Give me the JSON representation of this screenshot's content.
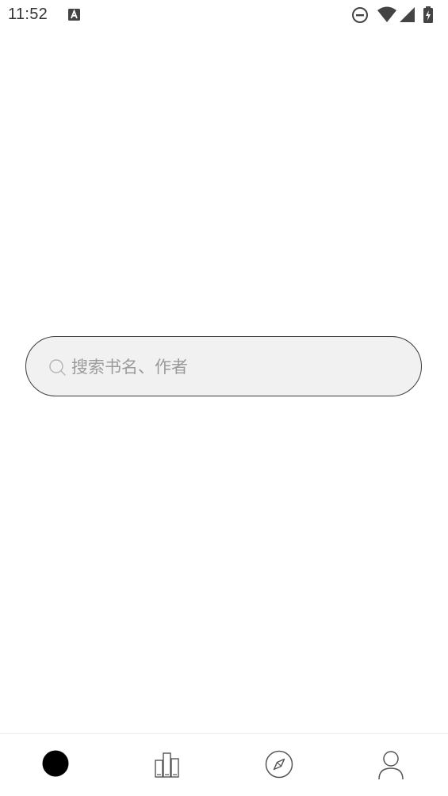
{
  "status_bar": {
    "time": "11:52",
    "notification_icon": "a-icon",
    "right_icons": [
      "do-not-disturb-icon",
      "wifi-icon",
      "cell-signal-icon",
      "battery-charging-icon"
    ]
  },
  "search": {
    "placeholder": "搜索书名、作者",
    "icon": "search-icon",
    "background_color": "#f1f1f1",
    "border_color": "#3a3a3a",
    "placeholder_color": "#9b9b9b"
  },
  "bottom_nav": {
    "items": [
      {
        "icon": "home-dot-icon",
        "active": true
      },
      {
        "icon": "bookshelf-icon",
        "active": false
      },
      {
        "icon": "compass-icon",
        "active": false
      },
      {
        "icon": "profile-icon",
        "active": false
      }
    ],
    "active_color": "#000000",
    "inactive_color": "#555555"
  }
}
